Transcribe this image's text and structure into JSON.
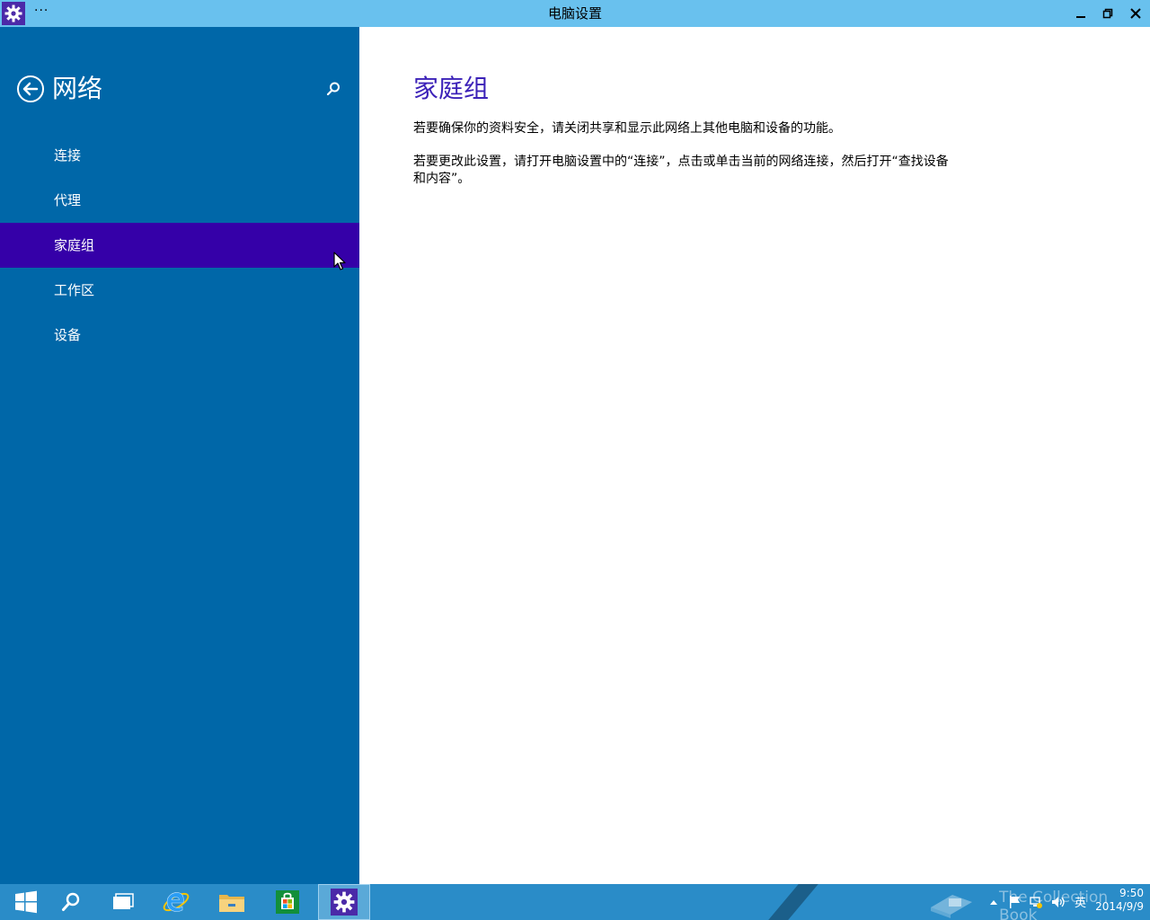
{
  "window": {
    "title": "电脑设置",
    "more_label": "···"
  },
  "sidebar": {
    "title": "网络",
    "items": [
      {
        "label": "连接"
      },
      {
        "label": "代理"
      },
      {
        "label": "家庭组"
      },
      {
        "label": "工作区"
      },
      {
        "label": "设备"
      }
    ],
    "selected_index": 2
  },
  "content": {
    "title": "家庭组",
    "paragraph1": "若要确保你的资料安全，请关闭共享和显示此网络上其他电脑和设备的功能。",
    "paragraph2": "若要更改此设置，请打开电脑设置中的“连接”，点击或单击当前的网络连接，然后打开“查找设备和内容”。"
  },
  "taskbar": {
    "apps": [
      "start-icon",
      "search-icon",
      "task-view-icon",
      "internet-explorer-icon",
      "file-explorer-icon",
      "store-icon",
      "settings-icon"
    ],
    "active_app": "settings-icon",
    "tray": {
      "language": "英",
      "time": "9:50",
      "date": "2014/9/9",
      "watermark": "The Collection Book"
    }
  },
  "colors": {
    "titlebar": "#69c1ee",
    "sidebar": "#0067a8",
    "selected": "#3500a8",
    "accent_title": "#3c22b8",
    "taskbar": "#2a8cc8"
  }
}
